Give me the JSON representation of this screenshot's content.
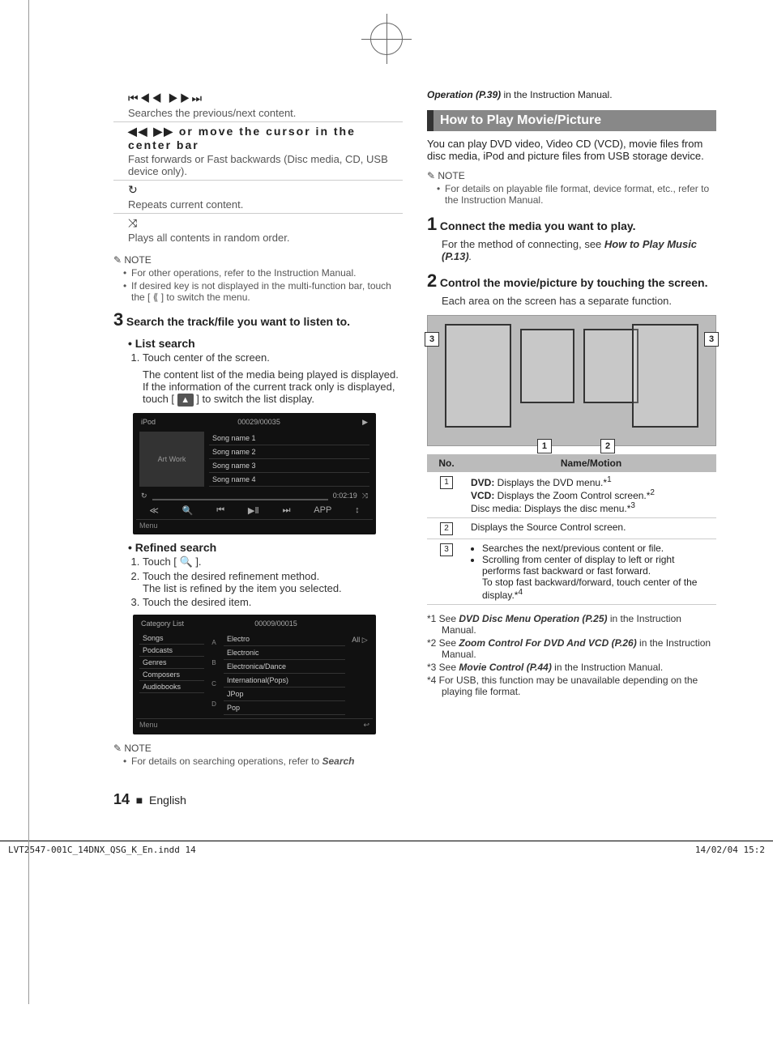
{
  "left": {
    "controls": [
      {
        "icons": "⏮◀◀ ▶▶⏭",
        "desc": "Searches the previous/next content."
      },
      {
        "icons": "◀◀ ▶▶ or move the cursor in the center bar",
        "desc": "Fast forwards or Fast backwards (Disc media, CD, USB device only).",
        "bold_icons": true
      },
      {
        "icons": "↻",
        "desc": "Repeats current content."
      },
      {
        "icons": "⤨",
        "desc": "Plays all contents in random order."
      }
    ],
    "note_label": "NOTE",
    "note_items": [
      "For other operations, refer to the Instruction Manual.",
      "If desired key is not displayed in the multi-function bar, touch the [ ⟪ ] to switch the menu."
    ],
    "step3": {
      "num": "3",
      "title": "Search the track/file you want to listen to.",
      "list_search": {
        "title": "List search",
        "items": [
          "Touch center of the screen."
        ],
        "sub1": "The content list of the media being played is displayed.",
        "sub2a": "If the information of the current track only is displayed, touch [ ",
        "sub2b": " ] to switch the list display."
      },
      "screenshot1": {
        "source": "iPod",
        "counter": "00029/00035",
        "art": "Art Work",
        "rows": [
          "Song name 1",
          "Song name 2",
          "Song name 3",
          "Song name 4"
        ],
        "time": "0:02:19",
        "menu": "Menu",
        "app": "APP"
      },
      "refined": {
        "title": "Refined search",
        "items": [
          "Touch [ 🔍 ].",
          "Touch the desired refinement method.",
          "Touch the desired item."
        ],
        "sub": "The list is refined by the item you selected."
      },
      "screenshot2": {
        "title": "Category List",
        "counter": "00009/00015",
        "side": [
          "Songs",
          "Podcasts",
          "Genres",
          "Composers",
          "Audiobooks"
        ],
        "abc": [
          "A",
          "B",
          "C",
          "D"
        ],
        "rows": [
          "Electro",
          "Electronic",
          "Electronica/Dance",
          "International(Pops)",
          "JPop",
          "Pop"
        ],
        "all": "All ▷",
        "menu": "Menu"
      }
    },
    "note2_label": "NOTE",
    "note2_item_a": "For details on searching operations, refer to ",
    "note2_item_b": "Search"
  },
  "right": {
    "cont_a": "Operation (P.39)",
    "cont_b": " in the Instruction Manual.",
    "section_title": "How to Play Movie/Picture",
    "intro": "You can play DVD video, Video CD (VCD), movie files from disc media, iPod and picture files from USB storage device.",
    "note_label": "NOTE",
    "note_item": "For details on playable file format, device format, etc., refer to the Instruction Manual.",
    "step1": {
      "num": "1",
      "title": "Connect the media you want to play.",
      "desc_a": "For the method of connecting, see ",
      "desc_b": "How to Play Music (P.13)",
      "desc_c": "."
    },
    "step2": {
      "num": "2",
      "title": "Control the movie/picture by touching the screen.",
      "desc": "Each area on the screen has a separate function."
    },
    "callouts": {
      "c1": "1",
      "c2": "2",
      "c3l": "3",
      "c3r": "3"
    },
    "table": {
      "h1": "No.",
      "h2": "Name/Motion",
      "row1_a": "DVD:",
      "row1_b": " Displays the DVD menu.*",
      "row1_s1": "1",
      "row1_c": "VCD:",
      "row1_d": " Displays the Zoom Control screen.*",
      "row1_s2": "2",
      "row1_e": "Disc media:",
      "row1_f": " Displays the disc menu.*",
      "row1_s3": "3",
      "row2": "Displays the Source Control screen.",
      "row3_a": "Searches the next/previous content or file.",
      "row3_b": "Scrolling from center of display to left or right performs fast backward or fast forward.",
      "row3_c": "To stop fast backward/forward, touch center of the display.*",
      "row3_s4": "4",
      "n1": "1",
      "n2": "2",
      "n3": "3"
    },
    "footnotes": {
      "f1a": "*1 See ",
      "f1b": "DVD Disc Menu Operation (P.25)",
      "f1c": " in the Instruction Manual.",
      "f2a": "*2 See ",
      "f2b": "Zoom Control For DVD And VCD (P.26)",
      "f2c": " in the Instruction Manual.",
      "f3a": "*3 See ",
      "f3b": "Movie Control (P.44)",
      "f3c": " in the Instruction Manual.",
      "f4": "*4 For USB, this function may be unavailable depending on the playing file format."
    }
  },
  "footer": {
    "page": "14",
    "lang": "English",
    "file": "LVT2547-001C_14DNX_QSG_K_En.indd   14",
    "date": "14/02/04   15:2"
  }
}
